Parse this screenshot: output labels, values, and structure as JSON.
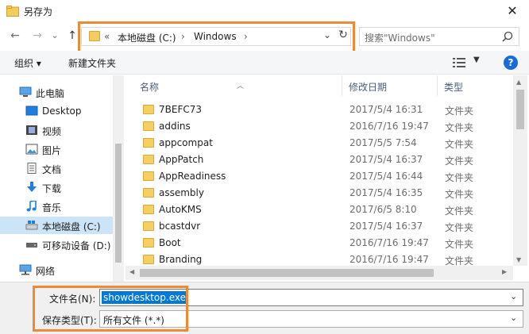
{
  "window": {
    "title": "另存为",
    "close_glyph": "✕"
  },
  "nav": {
    "back_glyph": "←",
    "forward_glyph": "→",
    "recent_glyph": "⌄",
    "up_glyph": "↑",
    "address": {
      "prefix": "«",
      "segments": [
        "本地磁盘 (C:)",
        "Windows"
      ],
      "separator": "›",
      "dropdown_glyph": "⌄",
      "refresh_glyph": "↻"
    },
    "search": {
      "placeholder": "搜索\"Windows\""
    }
  },
  "toolbar": {
    "organize": "组织 ▾",
    "new_folder": "新建文件夹",
    "help": "?"
  },
  "sidebar": {
    "items": [
      {
        "label": "此电脑",
        "icon": "computer-icon"
      },
      {
        "label": "Desktop",
        "icon": "desktop-icon"
      },
      {
        "label": "视频",
        "icon": "video-icon"
      },
      {
        "label": "图片",
        "icon": "pictures-icon"
      },
      {
        "label": "文档",
        "icon": "documents-icon"
      },
      {
        "label": "下载",
        "icon": "download-icon"
      },
      {
        "label": "音乐",
        "icon": "music-icon"
      },
      {
        "label": "本地磁盘 (C:)",
        "icon": "drive-icon",
        "selected": true
      },
      {
        "label": "可移动设备 (D:)",
        "icon": "removable-drive-icon"
      },
      {
        "label": "网络",
        "icon": "network-icon"
      }
    ]
  },
  "filelist": {
    "columns": {
      "name": "名称",
      "date": "修改日期",
      "type": "类型"
    },
    "rows": [
      {
        "name": "7BEFC73",
        "date": "2017/5/4 16:31",
        "type": "文件夹"
      },
      {
        "name": "addins",
        "date": "2016/7/16 19:47",
        "type": "文件夹"
      },
      {
        "name": "appcompat",
        "date": "2017/5/5 7:54",
        "type": "文件夹"
      },
      {
        "name": "AppPatch",
        "date": "2017/5/4 16:37",
        "type": "文件夹"
      },
      {
        "name": "AppReadiness",
        "date": "2017/5/4 16:44",
        "type": "文件夹"
      },
      {
        "name": "assembly",
        "date": "2017/5/4 16:35",
        "type": "文件夹"
      },
      {
        "name": "AutoKMS",
        "date": "2017/6/5 8:10",
        "type": "文件夹"
      },
      {
        "name": "bcastdvr",
        "date": "2017/5/4 16:37",
        "type": "文件夹"
      },
      {
        "name": "Boot",
        "date": "2016/7/16 19:47",
        "type": "文件夹"
      },
      {
        "name": "Branding",
        "date": "2016/7/16 19:47",
        "type": "文件夹"
      }
    ]
  },
  "bottom": {
    "filename_label": "文件名(N):",
    "filename_value": "showdesktop.exe",
    "filetype_label": "保存类型(T):",
    "filetype_value": "所有文件  (*.*)"
  },
  "colors": {
    "highlight": "#ee8a33",
    "selection": "#0078d7",
    "sidebar_selected": "#cce4f7"
  }
}
